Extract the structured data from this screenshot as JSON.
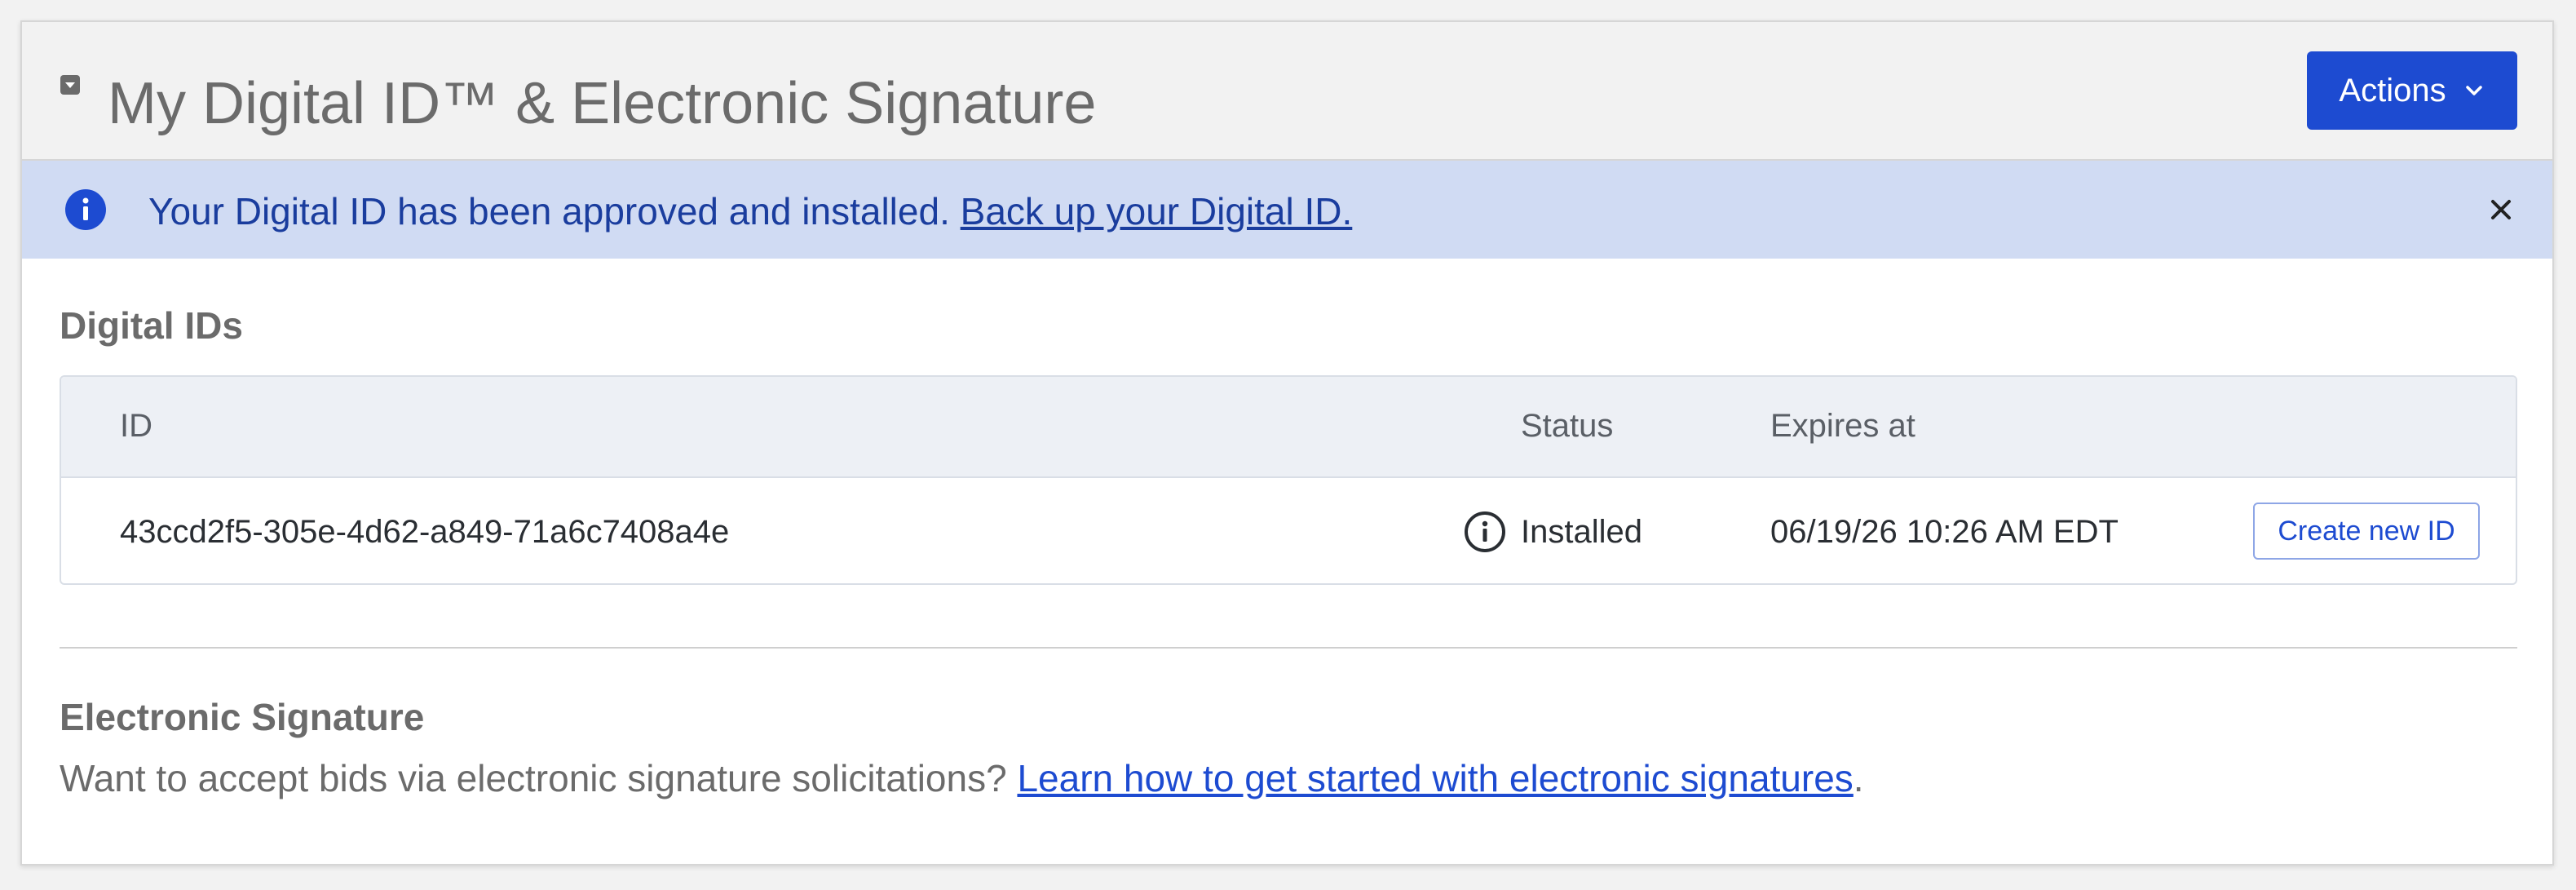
{
  "header": {
    "title": "My Digital ID™ & Electronic Signature",
    "collapse_icon": "caret-down-square-icon",
    "actions_label": "Actions",
    "actions_icon": "chevron-down-icon"
  },
  "alert": {
    "icon": "info-circle-icon",
    "message": "Your Digital ID has been approved and installed.",
    "link_text": "Back up your Digital ID.",
    "close_icon": "close-icon",
    "background": "#d0dbf3",
    "text_color": "#1a3d9e"
  },
  "digital_ids": {
    "title": "Digital IDs",
    "columns": [
      "ID",
      "Status",
      "Expires at"
    ],
    "rows": [
      {
        "id": "43ccd2f5-305e-4d62-a849-71a6c7408a4e",
        "status_icon": "info-circle-outline-icon",
        "status": "Installed",
        "expires_at": "06/19/26 10:26 AM EDT",
        "action_label": "Create new ID"
      }
    ]
  },
  "electronic_signature": {
    "title": "Electronic Signature",
    "text": "Want to accept bids via electronic signature solicitations?",
    "link_text": "Learn how to get started with electronic signatures",
    "trailing": "."
  },
  "colors": {
    "primary": "#1d4bd1",
    "muted_text": "#6b6b6b",
    "header_bg": "#f2f2f2"
  }
}
